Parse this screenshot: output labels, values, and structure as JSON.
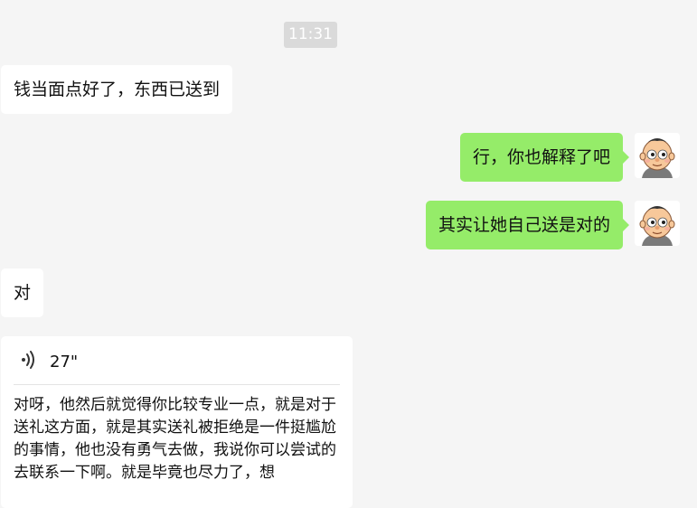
{
  "chat": {
    "timestamp": "11:31",
    "messages": [
      {
        "side": "left",
        "text": "钱当面点好了，东西已送到"
      },
      {
        "side": "right",
        "text": "行，你也解释了吧"
      },
      {
        "side": "right",
        "text": "其实让她自己送是对的"
      },
      {
        "side": "left",
        "text": "对"
      }
    ],
    "voice_message": {
      "icon": "voice-wave-icon",
      "duration": "27\"",
      "transcript": "对呀，他然后就觉得你比较专业一点，就是对于送礼这方面，就是其实送礼被拒绝是一件挺尴尬的事情，他也没有勇气去做，我说你可以尝试的去联系一下啊。就是毕竟也尽力了，想"
    }
  },
  "colors": {
    "background": "#f5f5f5",
    "incoming_bubble": "#ffffff",
    "outgoing_bubble": "#95ec69",
    "timestamp_bg": "#dadada"
  }
}
